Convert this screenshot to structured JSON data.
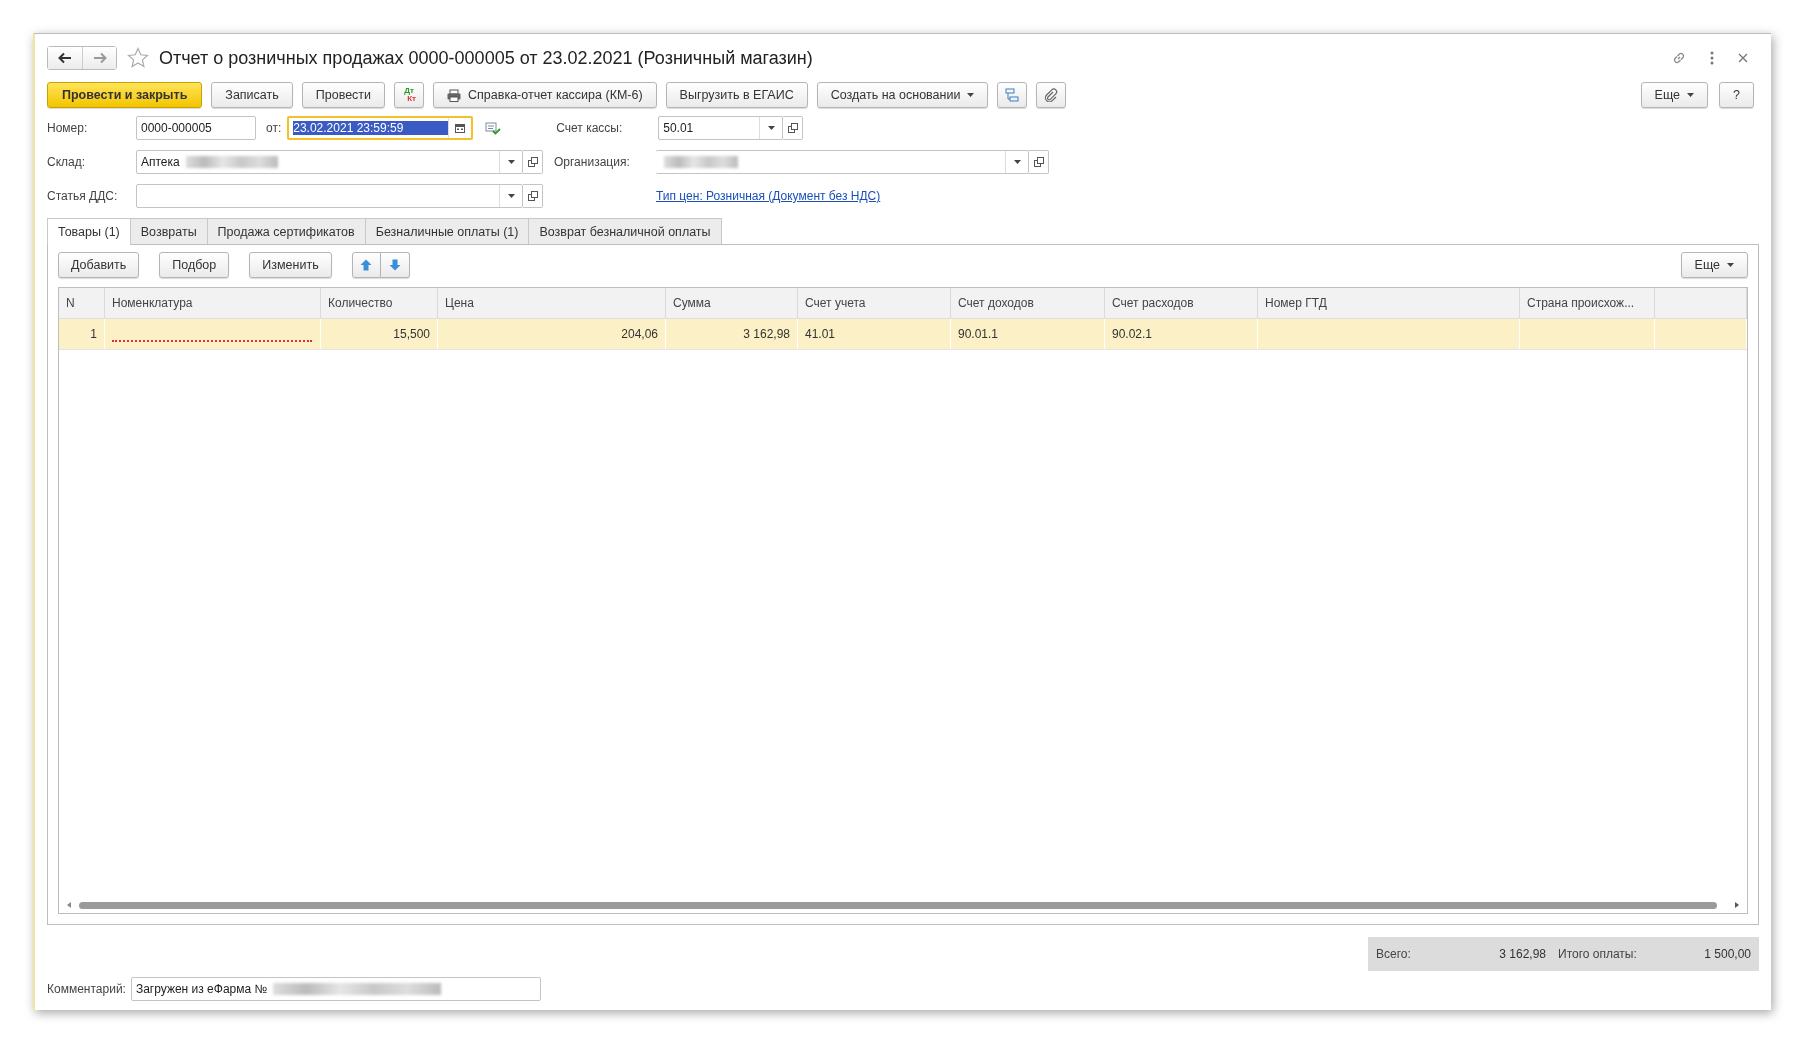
{
  "window": {
    "title": "Отчет о розничных продажах 0000-000005 от 23.02.2021 (Розничный магазин)",
    "favorite": false
  },
  "toolbar": [
    {
      "kind": "primary",
      "label": "Провести и закрыть"
    },
    {
      "kind": "plain",
      "label": "Записать"
    },
    {
      "kind": "plain",
      "label": "Провести"
    },
    {
      "kind": "dtkt",
      "top": "Дт",
      "bottom": "Кт"
    },
    {
      "kind": "print",
      "label": "Справка-отчет кассира (КМ-6)"
    },
    {
      "kind": "plain",
      "label": "Выгрузить в ЕГАИС"
    },
    {
      "kind": "menu",
      "label": "Создать на основании"
    },
    {
      "kind": "structure"
    },
    {
      "kind": "attach"
    }
  ],
  "toolbar_right": [
    {
      "kind": "menu",
      "label": "Еще"
    },
    {
      "kind": "plain",
      "label": "?"
    }
  ],
  "fields": {
    "number": {
      "label": "Номер:",
      "value": "0000-000005"
    },
    "date": {
      "label": "от:",
      "value": "23.02.2021 23:59:59",
      "focused": true
    },
    "cash_account": {
      "label": "Счет кассы:",
      "value": "50.01"
    },
    "warehouse": {
      "label": "Склад:",
      "value": "Аптека"
    },
    "organization": {
      "label": "Организация:"
    },
    "cash_flow_item": {
      "label": "Статья ДДС:"
    },
    "price_type_link": "Тип цен: Розничная (Документ без НДС)"
  },
  "tabs": [
    {
      "label": "Товары (1)",
      "selected": true
    },
    {
      "label": "Возвраты",
      "selected": false
    },
    {
      "label": "Продажа сертификатов",
      "selected": false
    },
    {
      "label": "Безналичные оплаты (1)",
      "selected": false
    },
    {
      "label": "Возврат безналичной оплаты",
      "selected": false
    }
  ],
  "table_toolbar": [
    {
      "kind": "plain",
      "label": "Добавить"
    },
    {
      "kind": "plain",
      "label": "Подбор"
    },
    {
      "kind": "plain",
      "label": "Изменить"
    },
    {
      "kind": "up"
    },
    {
      "kind": "down"
    }
  ],
  "table_toolbar_right": [
    {
      "kind": "menu",
      "label": "Еще"
    }
  ],
  "table": {
    "columns": [
      "N",
      "Номенклатура",
      "Количество",
      "Цена",
      "Сумма",
      "Счет учета",
      "Счет доходов",
      "Счет расходов",
      "Номер ГТД",
      "Страна происхож..."
    ],
    "rows": [
      {
        "selected": true,
        "cells": [
          "1",
          "",
          "15,500",
          "204,06",
          "3 162,98",
          "41.01",
          "90.01.1",
          "90.02.1",
          "",
          ""
        ],
        "invalid": [
          false,
          true,
          false,
          false,
          false,
          false,
          false,
          false,
          false,
          false
        ]
      }
    ]
  },
  "totals": [
    {
      "label": "Всего:",
      "value": "3 162,98"
    },
    {
      "label": "Итого оплаты:",
      "value": "1 500,00"
    }
  ],
  "comment": {
    "label": "Комментарий:",
    "value": "Загружен из еФарма №"
  }
}
